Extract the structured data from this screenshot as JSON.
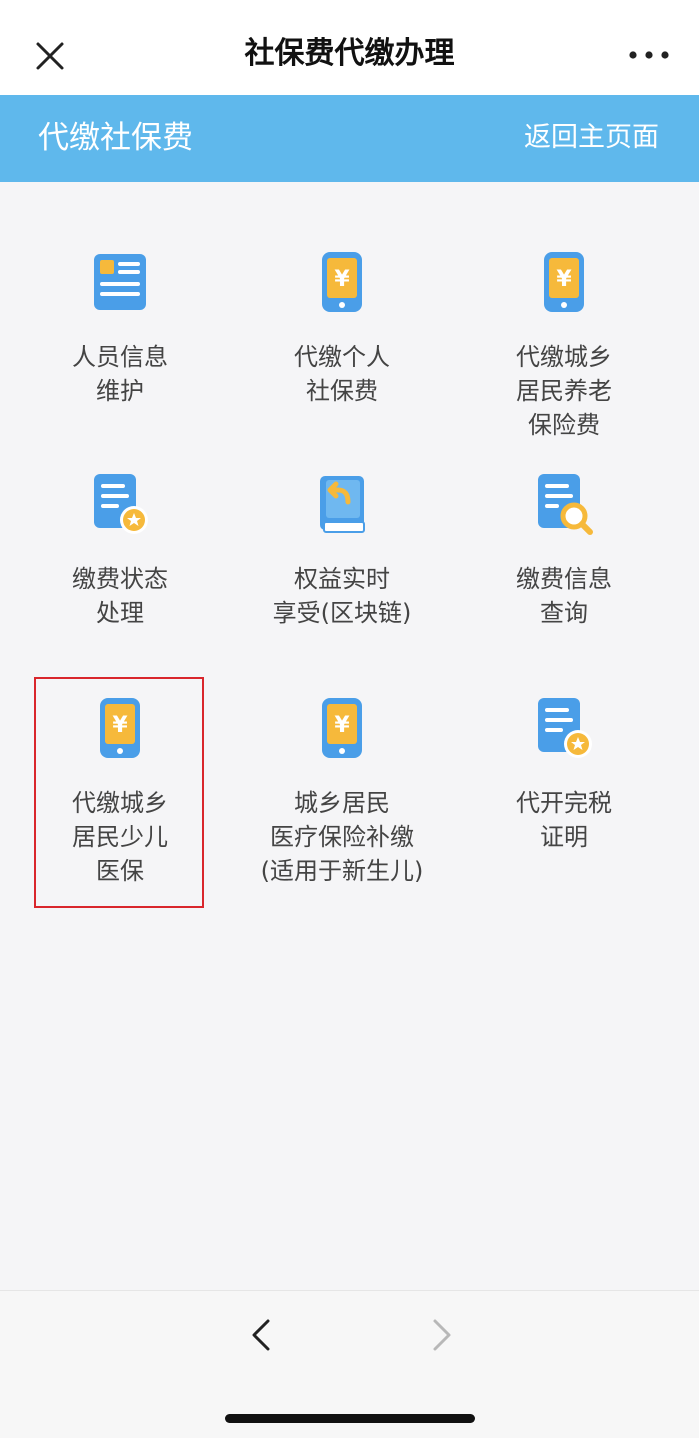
{
  "nav": {
    "title": "社保费代缴办理",
    "close_icon": "close-icon",
    "more_icon": "more-icon"
  },
  "header": {
    "title": "代缴社保费",
    "home_link": "返回主页面"
  },
  "colors": {
    "header_bg": "#5fb8ec",
    "icon_blue": "#4a9ee8",
    "icon_yellow": "#f6b93b",
    "highlight_border": "#d9262c"
  },
  "tiles": [
    {
      "icon": "id-card-icon",
      "lines": [
        "人员信息",
        "维护"
      ]
    },
    {
      "icon": "phone-yen-icon",
      "lines": [
        "代缴个人",
        "社保费"
      ]
    },
    {
      "icon": "phone-yen-icon",
      "lines": [
        "代缴城乡",
        "居民养老",
        "保险费"
      ]
    },
    {
      "icon": "document-star-icon",
      "lines": [
        "缴费状态",
        "处理"
      ]
    },
    {
      "icon": "book-return-icon",
      "lines": [
        "权益实时",
        "享受(区块链)"
      ]
    },
    {
      "icon": "document-search-icon",
      "lines": [
        "缴费信息",
        "查询"
      ]
    },
    {
      "icon": "phone-yen-icon",
      "lines": [
        "代缴城乡",
        "居民少儿",
        "医保"
      ]
    },
    {
      "icon": "phone-yen-icon",
      "lines": [
        "城乡居民",
        "医疗保险补缴",
        "(适用于新生儿)"
      ]
    },
    {
      "icon": "document-star-icon",
      "lines": [
        "代开完税",
        "证明"
      ]
    }
  ],
  "bottom": {
    "back_icon": "chevron-left-icon",
    "forward_icon": "chevron-right-icon"
  }
}
